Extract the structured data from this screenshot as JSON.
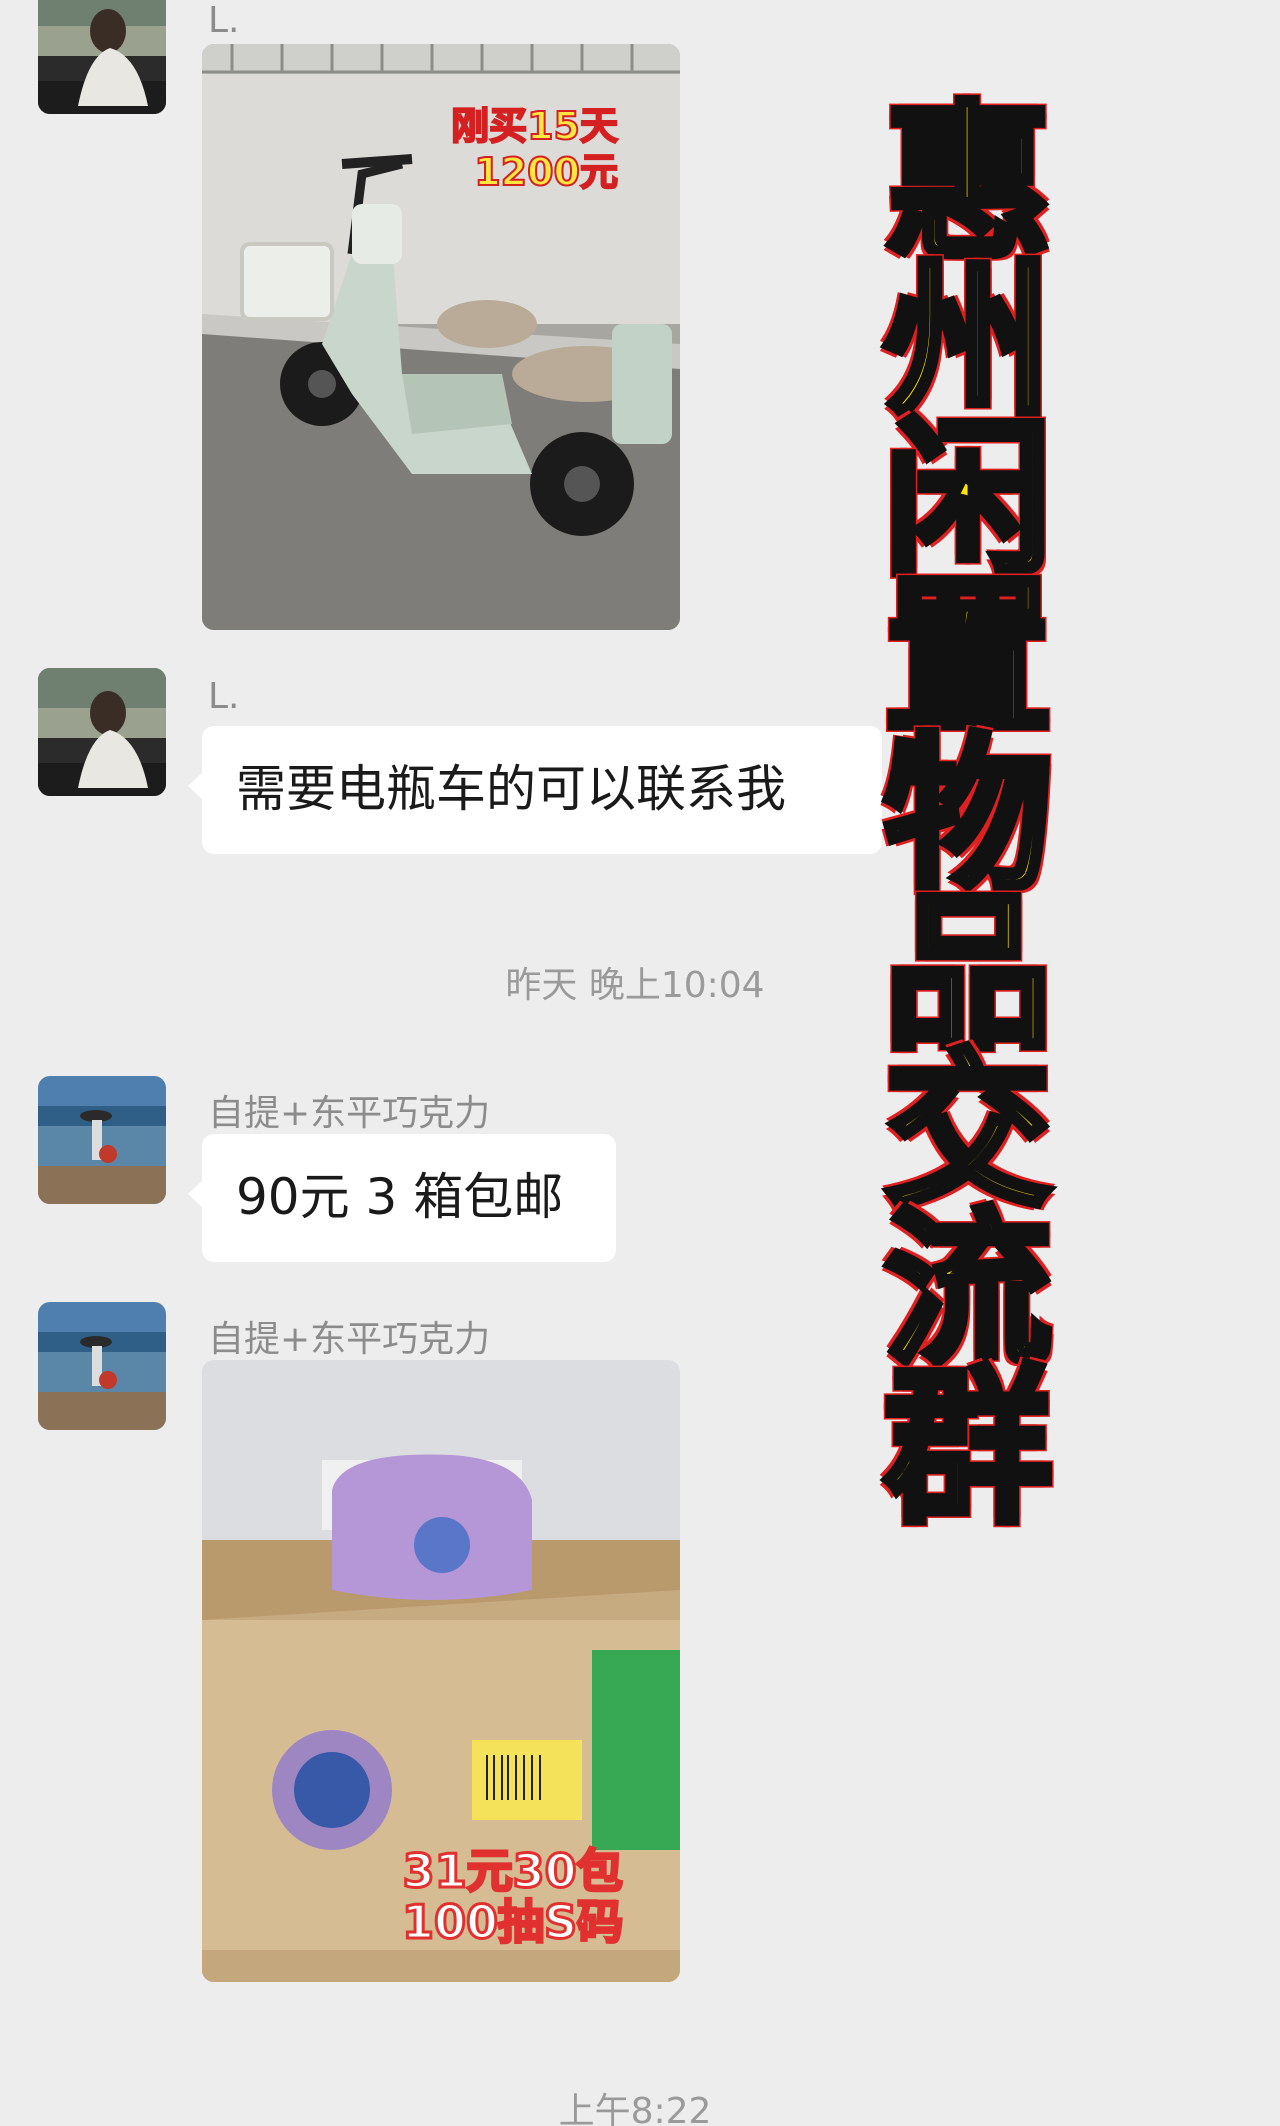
{
  "messages": [
    {
      "sender": "L.",
      "type": "image",
      "overlay": [
        "刚买15天",
        "1200元"
      ]
    },
    {
      "sender": "L.",
      "type": "text",
      "text": "需要电瓶车的可以联系我"
    },
    {
      "type": "time",
      "text": "昨天 晚上10:04"
    },
    {
      "sender": "自提+东平巧克力",
      "type": "text",
      "text": "90元 3 箱包邮"
    },
    {
      "sender": "自提+东平巧克力",
      "type": "image",
      "overlay": [
        "31元30包",
        "100抽S码"
      ]
    },
    {
      "type": "time",
      "text": "上午8:22"
    }
  ],
  "banner": {
    "chars": [
      "惠",
      "州",
      "闲",
      "置",
      "物",
      "品",
      "交",
      "流",
      "群"
    ]
  },
  "colors": {
    "background": "#ededed",
    "bubble": "#ffffff",
    "banner_fill": "#ffe400",
    "banner_outline": "#e02020"
  }
}
